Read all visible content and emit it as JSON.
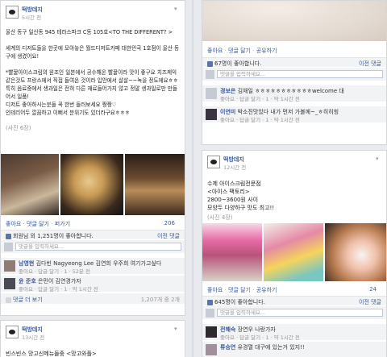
{
  "left_post1": {
    "page_name": "떡방데지",
    "time": "5시간 전",
    "text": "울산 동구 일산동 945 테라스파크 C동 105호<TO THE DIFFERENT? >\n\n세계의 디저트들을 한곳에 모아놓은 월드디저트카페 대한민국 1호점이 울산 동구에 생겼어요!\n\n*빨꿀아이스크림의 원조인 일본에서 공수해온 빨꿀이라 맛이 좋구요 치즈케익같은것도 프랑스에서 직접 들여온 것이라 입안에서 살살~~녹을 정도에요ㅎㅎ\n특히 음료중에서 생과일은 전혀 다른 재료들어가지 않고 정말 생과일로만 만들어서 일품!\n디저트 좋아하시는분들 꼭 한번 들러보세요 짱짱♡\n인테리어두 깔끔하고 이뻐서 분위기도 있더라구요ㅎㅎㅎ",
    "photo_count": "(사진 6장)",
    "actions": [
      "좋아요",
      "댓글 달기",
      "퍼가기"
    ],
    "share_count": "206",
    "likes_text": "회원님 외 1,251명이 좋아합니다.",
    "prev_comments": "이전 댓글",
    "comment_placeholder": "댓글을 입력하세요...",
    "comments": [
      {
        "name": "남영현",
        "text": "김다빈 Nagyeong Lee 김연희 우주희 여기가고싶다",
        "meta": "좋아요 · 답글 달기 · 1 · 52분 전"
      },
      {
        "name": "윤 준호",
        "text": "은민이 김연경가자",
        "meta": "좋아요 · 답글 달기 · 1 · 약 1시간 전"
      }
    ],
    "more_comments": "댓글 더 보기",
    "more_count": "1,207개 중 2개"
  },
  "left_post2": {
    "page_name": "떡방데지",
    "time": "13시간 전",
    "text": "빈스빈스 망고신메뉴들중 <망고와플>"
  },
  "right_post1": {
    "actions": [
      "좋아요",
      "댓글 달기",
      "공유하기"
    ],
    "likes_text": "67명이 좋아합니다.",
    "prev_comments": "이전 댓글",
    "comment_placeholder": "댓글을 입력하세요...",
    "comments": [
      {
        "name": "경보은",
        "text": "김채일 ㅎㅎㅎㅎㅎㅎㅎㅎㅎㅎㅎwelcome 대",
        "meta": "좋아요 · 답글 달기 · 1 · 약 1시간 전"
      },
      {
        "name": "이연미",
        "text": "박소진맛있다 내가 먼저 가볼께~_ㅎ히히힝",
        "meta": "좋아요 · 답글 달기 · 1 · 약 1시간 전"
      }
    ]
  },
  "right_post2": {
    "page_name": "떡방데지",
    "time": "12시간 전",
    "text": "수제 아이스크림전문점\n<아이스 팩토리>\n2800~3600원 사이\n모양두 다양하구 맛도 최고!!",
    "photo_count": "(사진 4장)",
    "actions": [
      "좋아요",
      "댓글 달기",
      "공유하기"
    ],
    "share_count": "24",
    "likes_text": "645명이 좋아합니다.",
    "prev_comments": "이전 댓글",
    "comment_placeholder": "댓글을 입력하세요...",
    "comments": [
      {
        "name": "전해숙",
        "text": "장연우 나랑가자",
        "meta": "좋아요 · 답글 달기 · 1 · 약 1시간 전"
      },
      {
        "name": "류승연",
        "text": "유경열 대구에 있는거 있지!!",
        "meta": ""
      }
    ]
  },
  "colors": {
    "link": "#3b5998",
    "bg": "#e9eaed"
  }
}
